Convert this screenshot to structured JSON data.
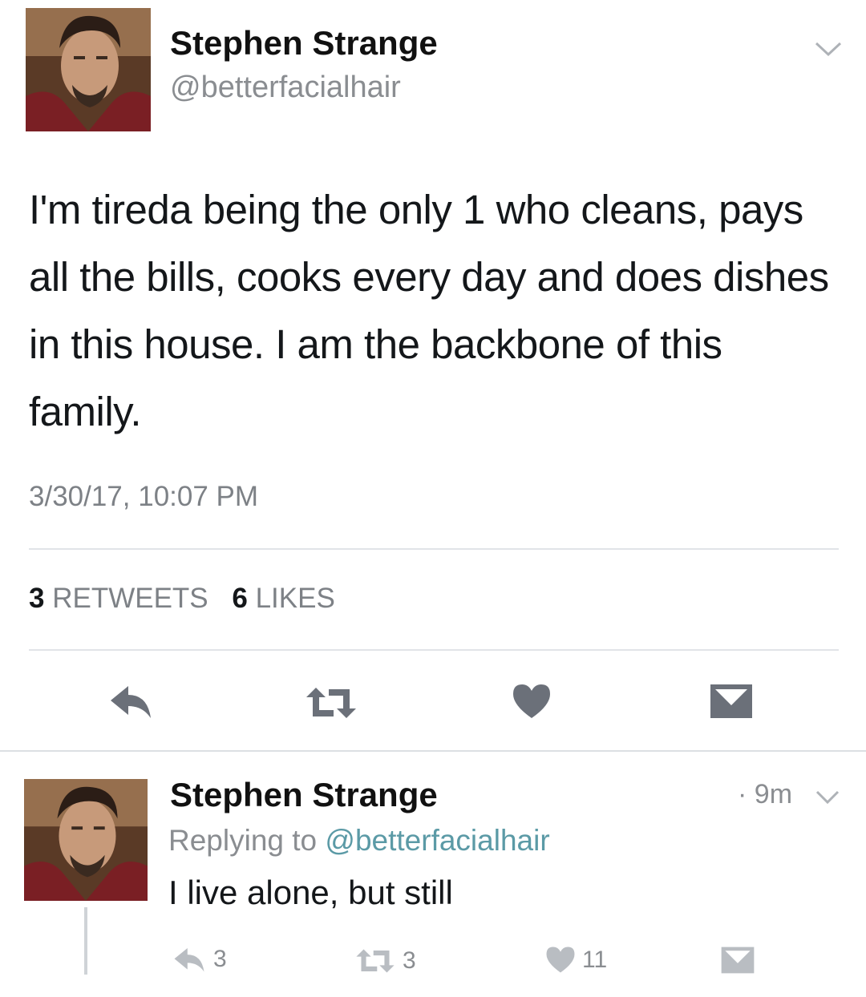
{
  "tweet": {
    "name": "Stephen Strange",
    "handle": "@betterfacialhair",
    "text": "I'm tireda being the only 1 who cleans, pays all the bills, cooks every day and does dishes in this house. I am the backbone of this family.",
    "timestamp": "3/30/17, 10:07 PM",
    "retweets_count": "3",
    "retweets_label": "RETWEETS",
    "likes_count": "6",
    "likes_label": "LIKES",
    "actions": [
      "reply-icon",
      "retweet-icon",
      "heart-icon",
      "message-icon"
    ]
  },
  "reply": {
    "name": "Stephen Strange",
    "time": "9m",
    "replying_prefix": "Replying to",
    "replying_handle": "@betterfacialhair",
    "text": "I live alone, but still",
    "reply_count": "3",
    "retweet_count": "3",
    "like_count": "11"
  },
  "colors": {
    "icon_gray": "#6b7079",
    "light_icon_gray": "#b9bdc2",
    "link": "#5b9aa6"
  }
}
